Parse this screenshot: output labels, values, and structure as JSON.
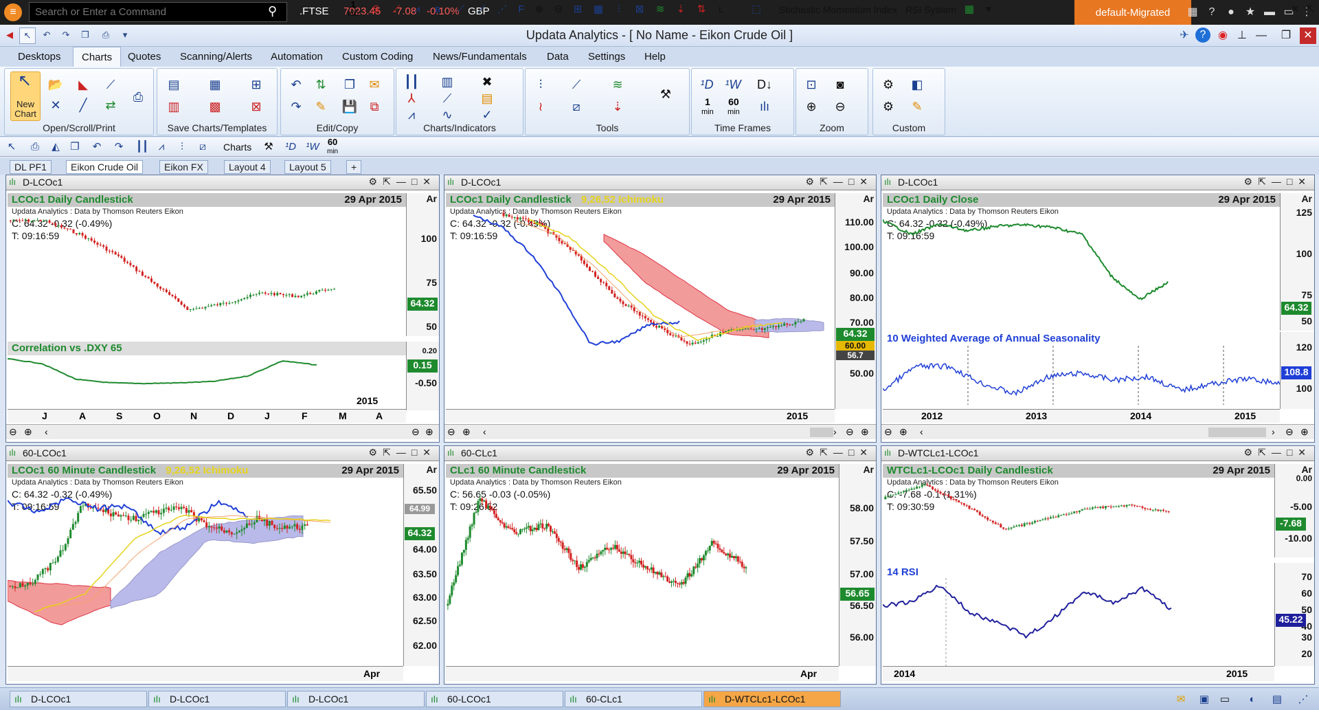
{
  "topbar": {
    "search_placeholder": "Search or Enter a Command",
    "symbol": ".FTSE",
    "price": "7023.45",
    "change": "-7.08",
    "pct": "-0.10%",
    "currency": "GBP",
    "profile": "default-Migrated"
  },
  "window": {
    "title": "Updata Analytics - [ No Name - Eikon Crude Oil ]"
  },
  "menu": [
    "Desktops",
    "Charts",
    "Quotes",
    "Scanning/Alerts",
    "Automation",
    "Custom Coding",
    "News/Fundamentals",
    "Data",
    "Settings",
    "Help"
  ],
  "ribbon": {
    "groups": [
      "Open/Scroll/Print",
      "Save Charts/Templates",
      "Edit/Copy",
      "Charts/Indicators",
      "Tools",
      "Time Frames",
      "Zoom",
      "Custom"
    ],
    "new_chart": "New",
    "new_chart2": "Chart",
    "tf1": "1",
    "tf1u": "min",
    "tf60": "60",
    "tf60u": "min"
  },
  "toolbar": {
    "charts": "Charts",
    "tf60": "60",
    "tf1": "1",
    "min": "min",
    "stoch": "Stichastic Momentum Index",
    "rsi": "RSI System"
  },
  "layout_tabs": [
    "DL PF1",
    "Eikon Crude Oil",
    "Eikon FX",
    "Layout 4",
    "Layout 5",
    "+"
  ],
  "common": {
    "note": "Updata Analytics : Data by Thomson Reuters Eikon",
    "date": "29 Apr 2015",
    "ar": "Ar",
    "year2015": "2015",
    "apr": "Apr"
  },
  "panels": {
    "p1": {
      "header": "D-LCOc1",
      "title": "LCOc1 Daily Candlestick",
      "c": "C: 64.32  -0.32 (-0.49%)",
      "t": "T: 09:16:59",
      "y": [
        "100",
        "75",
        "50"
      ],
      "last": "64.32",
      "sub_title": "Correlation vs .DXY 65",
      "sub_y": [
        "0.20",
        "-0.50"
      ],
      "sub_last": "0.15",
      "x": [
        "J",
        "A",
        "S",
        "O",
        "N",
        "D",
        "J",
        "F",
        "M",
        "A"
      ]
    },
    "p2": {
      "header": "D-LCOc1",
      "title": "LCOc1 Daily Candlestick",
      "title2": "9,26,52 Ichimoku",
      "c": "C: 64.32  -0.32 (-0.49%)",
      "t": "T: 09:16:59",
      "y": [
        "110.00",
        "100.00",
        "90.00",
        "80.00",
        "70.00",
        "60.00",
        "50.00"
      ],
      "last": "64.32",
      "box2": "60.00",
      "box3": "56.7"
    },
    "p3": {
      "header": "D-LCOc1",
      "title": "LCOc1 Daily Close",
      "c": "C: 64.32  -0.32 (-0.49%)",
      "t": "T: 09:16:59",
      "y": [
        "125",
        "100",
        "75",
        "50"
      ],
      "last": "64.32",
      "sub_title": "10 Weighted Average of Annual Seasonality",
      "sub_y": [
        "120",
        "100"
      ],
      "sub_last": "108.8",
      "x": [
        "2012",
        "2013",
        "2014",
        "2015"
      ]
    },
    "p4": {
      "header": "60-LCOc1",
      "title": "LCOc1 60 Minute Candlestick",
      "title2": "9,26,52 Ichimoku",
      "c": "C: 64.32  -0.32 (-0.49%)",
      "t": "T: 09:16:59",
      "y": [
        "65.50",
        "65.00",
        "64.50",
        "64.00",
        "63.50",
        "63.00",
        "62.50",
        "62.00"
      ],
      "last": "64.32",
      "box2": "64.99"
    },
    "p5": {
      "header": "60-CLc1",
      "title": "CLc1 60 Minute Candlestick",
      "c": "C: 56.65  -0.03 (-0.05%)",
      "t": "T: 09:26:52",
      "y": [
        "58.00",
        "57.50",
        "57.00",
        "56.50",
        "56.00"
      ],
      "last": "56.65"
    },
    "p6": {
      "header": "D-WTCLc1-LCOc1",
      "title": "WTCLc1-LCOc1 Daily Candlestick",
      "c": "C: -7.68  -0.1 (1.31%)",
      "t": "T: 09:30:59",
      "y": [
        "0.00",
        "-5.00",
        "-10.00"
      ],
      "last": "-7.68",
      "sub_title": "14 RSI",
      "sub_y": [
        "70",
        "60",
        "50",
        "40",
        "30",
        "20"
      ],
      "sub_last": "45.22",
      "x": [
        "2014",
        "2015"
      ]
    }
  },
  "status_tabs": [
    "D-LCOc1",
    "D-LCOc1",
    "D-LCOc1",
    "60-LCOc1",
    "60-CLc1",
    "D-WTCLc1-LCOc1"
  ],
  "colors": {
    "green": "#1e8a2e",
    "red": "#d32020",
    "blue": "#1f3fd6",
    "orange": "#e87722"
  }
}
